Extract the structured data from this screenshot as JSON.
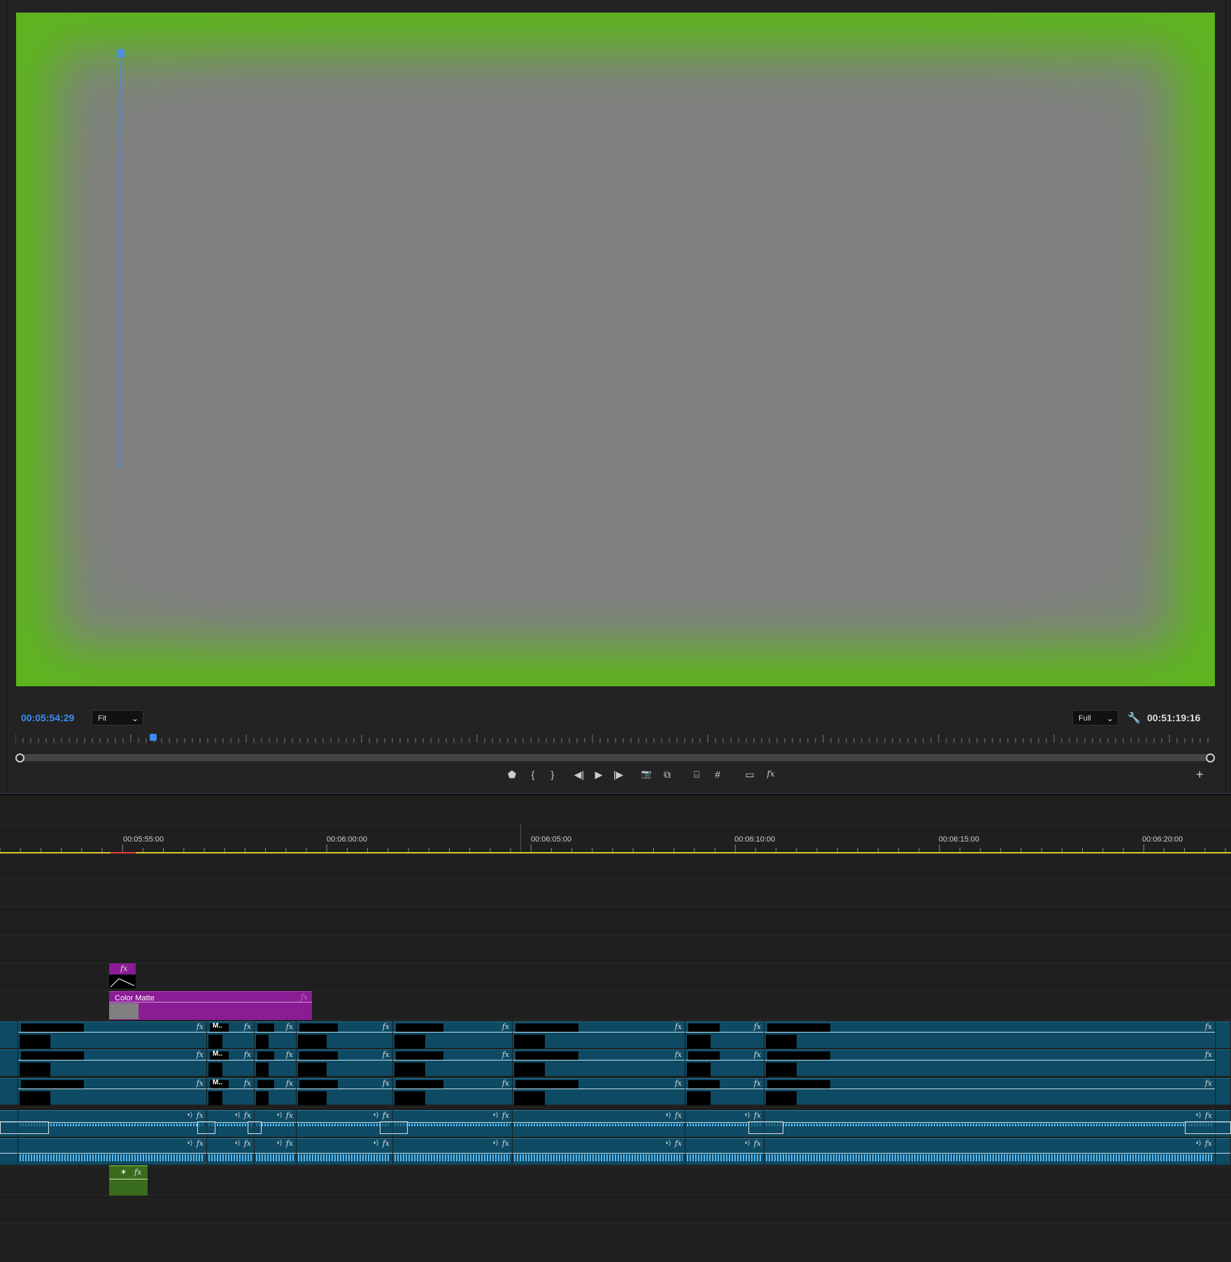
{
  "monitor": {
    "current_timecode": "00:05:54:29",
    "duration_timecode": "00:51:19:16",
    "zoom_select": "Fit",
    "resolution_select": "Full",
    "colors": {
      "matte_green": "#5db51d",
      "matte_gray": "#808080",
      "timecode_blue": "#3b8ef0"
    },
    "controls": [
      {
        "name": "add-marker-icon",
        "glyph": "⬟"
      },
      {
        "name": "mark-in-icon",
        "glyph": "{"
      },
      {
        "name": "mark-out-icon",
        "glyph": "}"
      },
      {
        "name": "step-back-icon",
        "glyph": "◀|"
      },
      {
        "name": "play-icon",
        "glyph": "▶"
      },
      {
        "name": "step-forward-icon",
        "glyph": "|▶"
      },
      {
        "name": "export-frame-icon",
        "glyph": "📷"
      },
      {
        "name": "compare-icon",
        "glyph": "⧉"
      },
      {
        "name": "safe-margins-icon",
        "glyph": "⌸"
      },
      {
        "name": "grid-icon",
        "glyph": "#"
      },
      {
        "name": "vr-toggle-icon",
        "glyph": "▭"
      },
      {
        "name": "fx-toggle-icon",
        "glyph": "fx"
      }
    ],
    "plus_label": "+"
  },
  "timeline": {
    "ruler_labels": [
      "00:05:55:00",
      "00:06:00:00",
      "00:06:05:00",
      "00:06:10:00",
      "00:06:15:00",
      "00:06:20:00"
    ],
    "color_matte_label": "Color Matte",
    "fx_label": "fx",
    "marker_label": "M..",
    "colors": {
      "ruler_yellow": "#d8c92b",
      "clip_teal": "#0e4a63",
      "matte_purple": "#8a1c94",
      "playhead_blue": "#4a8fe0"
    }
  }
}
